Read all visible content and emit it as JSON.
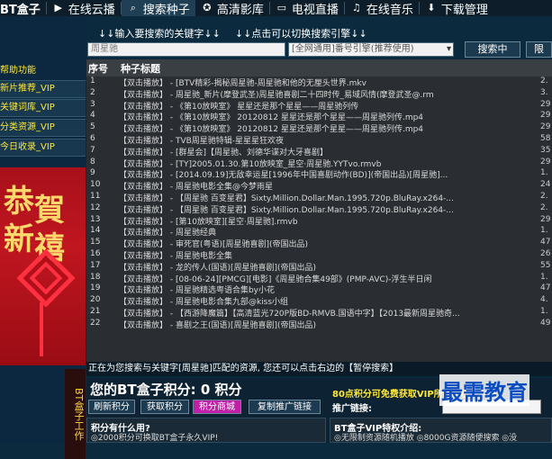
{
  "app": {
    "logo": "BT盒子",
    "tabs": [
      {
        "label": "在线云播",
        "icon": "play-icon"
      },
      {
        "label": "搜索种子",
        "icon": "search-icon"
      },
      {
        "label": "高清影库",
        "icon": "film-reel-icon"
      },
      {
        "label": "电视直播",
        "icon": "tv-icon"
      },
      {
        "label": "在线音乐",
        "icon": "music-note-icon"
      },
      {
        "label": "下载管理",
        "icon": "download-icon"
      }
    ]
  },
  "sidebar": {
    "help": "帮助功能",
    "items": [
      "新片推荐_VIP",
      "关键词库_VIP",
      "分类资源_VIP",
      "今日收录_VIP"
    ],
    "banner_text": [
      "恭",
      "賀",
      "新",
      "禧"
    ],
    "bt_box_text": "BT盒子工作"
  },
  "search": {
    "hint_keyword": "↓↓输入要搜索的关键字↓↓",
    "hint_engine": "↓↓点击可以切换搜索引擎↓↓",
    "keyword_value": "周星驰",
    "engine_value": "[全网通用]番号引擎(推荐使用)",
    "search_button": "搜索中",
    "limit_button": "限"
  },
  "results": {
    "col_no": "序号",
    "col_title": "种子标题",
    "col_size": "",
    "rows": [
      {
        "no": "1",
        "title": "【双击播放】 - [BTV精彩-揭秘周星驰-周星驰和他的无厘头世界.mkv",
        "num": "2."
      },
      {
        "no": "2",
        "title": "【双击播放】 - 周星驰_新片(摩登武圣)周星驰喜剧二十四时传_易域风情(摩登武圣@.rm",
        "num": "3."
      },
      {
        "no": "3",
        "title": "【双击播放】 - 《第10放映室》 星星还是那个星星——周星驰列传",
        "num": "29"
      },
      {
        "no": "4",
        "title": "【双击播放】 - 《第10放映室》 20120812 星星还是那个星星——周星驰列传.mp4",
        "num": "29"
      },
      {
        "no": "5",
        "title": "【双击播放】 - 《第10放映室》 20120812 星星还是那个星星——周星驰列传.mp4",
        "num": "29"
      },
      {
        "no": "6",
        "title": "【双击播放】 - TVB周星驰特辑-星星星狂欢夜",
        "num": "58"
      },
      {
        "no": "7",
        "title": "【双击播放】 - [群星会]【周星驰、刘德华谍对大牙喜剧】",
        "num": "35"
      },
      {
        "no": "8",
        "title": "【双击播放】 - [TY]2005.01.30.第10放映室_星空·周星驰.YYTvo.rmvb",
        "num": "29"
      },
      {
        "no": "9",
        "title": "【双击播放】 - [2014.09.19]无敌幸运星[1996年中国喜剧动作(BD)](帝国出品)[周星驰]...",
        "num": "1."
      },
      {
        "no": "10",
        "title": "【双击播放】 - 周星驰电影全集@今梦雨星",
        "num": "24"
      },
      {
        "no": "11",
        "title": "【双击播放】 - 【周星驰 百变星君】Sixty.Million.Dollar.Man.1995.720p.BluRay.x264-...",
        "num": "2."
      },
      {
        "no": "12",
        "title": "【双击播放】 - 【周星驰 百变星君】Sixty.Million.Dollar.Man.1995.720p.BluRay.x264-...",
        "num": "2."
      },
      {
        "no": "13",
        "title": "【双击播放】 - [第10放映室][星空·周星驰].rmvb",
        "num": "29"
      },
      {
        "no": "14",
        "title": "【双击播放】 - 周星驰经典",
        "num": "1."
      },
      {
        "no": "15",
        "title": "【双击播放】 - 审死官(粤语)[周星驰喜剧](帝国出品)",
        "num": "47"
      },
      {
        "no": "16",
        "title": "【双击播放】 - 周星驰电影全集",
        "num": "26"
      },
      {
        "no": "17",
        "title": "【双击播放】 - 龙的传人(国语)[周星驰喜剧](帝国出品)",
        "num": "55"
      },
      {
        "no": "18",
        "title": "【双击播放】 - [08-06-24][PMCG][电影]《周星驰合集49部》(PMP-AVC)-浮生半日闲",
        "num": "1."
      },
      {
        "no": "19",
        "title": "【双击播放】 - 周星驰精选粤语合集by小花",
        "num": "47"
      },
      {
        "no": "20",
        "title": "【双击播放】 - 周星驰电影合集九部@kiss小组",
        "num": "4."
      },
      {
        "no": "21",
        "title": "【双击播放】 - 【西游降魔篇】【高清蓝光720P版BD-RMVB.国语中字】【2013最新周星驰奇...",
        "num": "1."
      },
      {
        "no": "22",
        "title": "【双击播放】 - 喜剧之王(国语)[周星驰喜剧](帝国出品)",
        "num": "49"
      }
    ]
  },
  "status": {
    "text": "正在为您搜索与关键字[周星驰]匹配的资源, 您还可以点击右边的【暂停搜索】"
  },
  "bottom": {
    "points_label": "您的BT盒子积分: 0 积分",
    "free_vip": "80点积分可免费获取VIP所有特权——天",
    "buttons": [
      "刷新积分",
      "获取积分",
      "积分商城",
      "复制推广链接"
    ],
    "promo_label": "推广链接:",
    "promo_value": "",
    "points_use_title": "积分有什么用?",
    "points_use_item": "◎2000积分可换取BT盒子永久VIP!",
    "vip_title": "BT盒子VIP特权介绍:",
    "vip_items": "◎无限制资源随机播放 ◎8000G资源随便搜索 ◎没",
    "watermark": "最需教育"
  },
  "colors": {
    "accent_yellow": "#ffe83a",
    "banner_red": "#c01620",
    "mall_pink": "#c020a8"
  }
}
